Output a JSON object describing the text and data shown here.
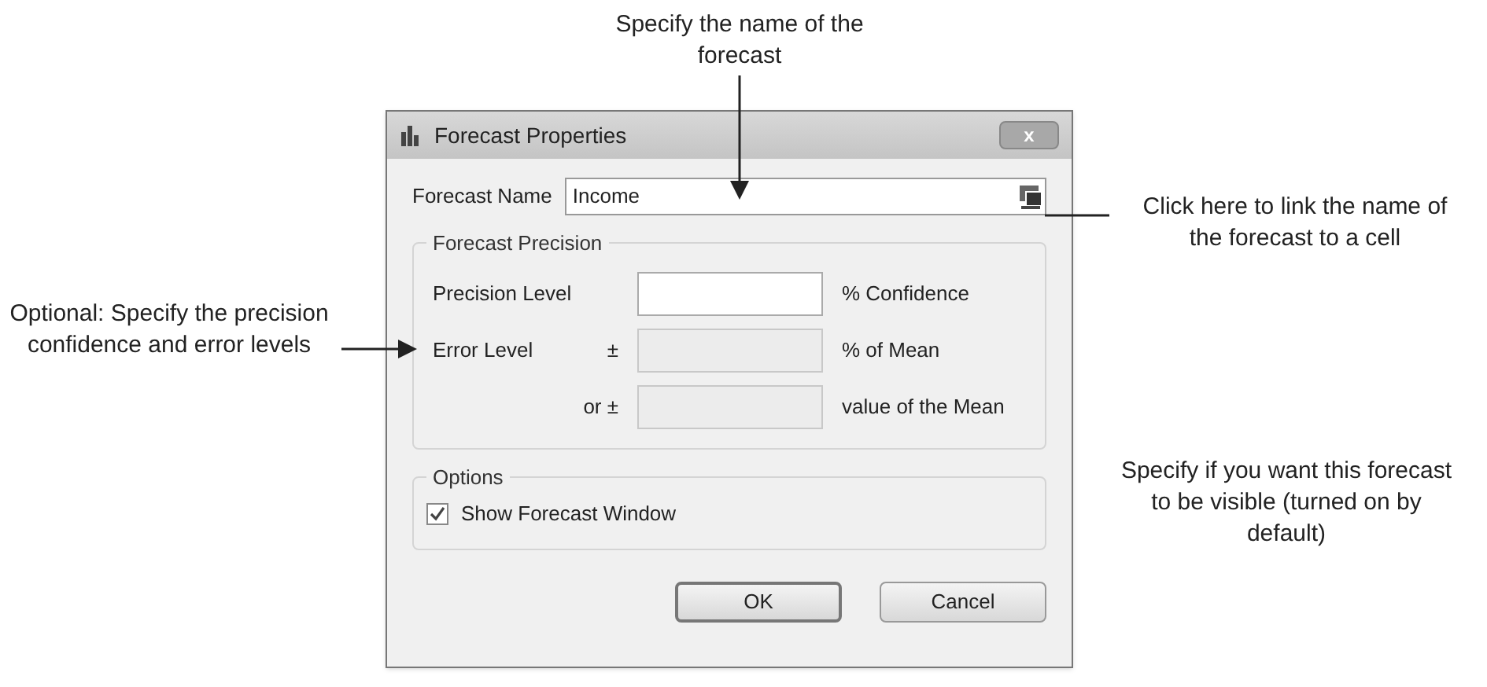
{
  "callouts": [
    {
      "kind": "top",
      "text": "Specify the name of the forecast"
    },
    {
      "kind": "right",
      "text": "Click here to link the name of the forecast to a cell"
    },
    {
      "kind": "left",
      "text": "Optional: Specify the precision confidence and error levels"
    },
    {
      "kind": "bottom_right",
      "text": "Specify if you want this forecast to be visible (turned on by default)"
    }
  ],
  "dialog": {
    "title": "Forecast Properties",
    "close": "x",
    "forecast_name": {
      "label": "Forecast Name",
      "value": "Income"
    },
    "precision": {
      "title": "Forecast Precision",
      "rows": [
        {
          "label": "Precision Level",
          "unit": "% Confidence",
          "disabled": false
        },
        {
          "label": "Error Level",
          "sign": "±",
          "unit": "% of Mean",
          "disabled": true
        },
        {
          "sign": "or ±",
          "unit": "value of the Mean",
          "disabled": true
        }
      ]
    },
    "options": {
      "title": "Options",
      "checkbox": {
        "label": "Show Forecast Window",
        "checked": true
      }
    },
    "buttons": [
      {
        "label": "OK",
        "default": true
      },
      {
        "label": "Cancel",
        "default": false
      }
    ]
  }
}
